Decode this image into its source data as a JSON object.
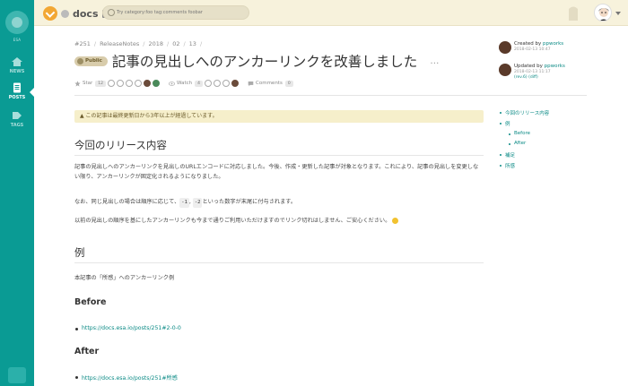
{
  "sidebar": {
    "team": "ESA",
    "items": [
      {
        "label": "NEWS"
      },
      {
        "label": "POSTS"
      },
      {
        "label": "TAGS"
      }
    ]
  },
  "topbar": {
    "brand": "docs",
    "search_placeholder": "Try category:foo tag:comments foobar"
  },
  "post": {
    "breadcrumb": [
      "#251",
      "ReleaseNotes",
      "2018",
      "02",
      "13"
    ],
    "badge": "Public",
    "title": "記事の見出しへのアンカーリンクを改善しました",
    "more": "…",
    "star_label": "Star",
    "star_count": "12",
    "watch_label": "Watch",
    "watch_count": "4",
    "comments_label": "Comments",
    "comments_count": "0"
  },
  "authors": {
    "created_prefix": "Created by",
    "created_by": "ppworks",
    "created_at": "2018-02-13 10:47",
    "updated_prefix": "Updated by",
    "updated_by": "ppworks",
    "updated_at": "2018-02-13 11:17",
    "revisions": "(rev.6) (diff)"
  },
  "alert": "この記事は最終更新日から3年以上が経過しています。",
  "content": {
    "h1_release": "今回のリリース内容",
    "p1": "記事の見出しへのアンカーリンクを見出しのURLエンコードに対応しました。今後、作成・更新した記事が対象となります。これにより、記事の見出しを変更しない限り、アンカーリンクが固定化されるようになりました。",
    "p2_pre": "なお、同じ見出しの場合は順序に応じて、",
    "p2_code1": "-1",
    "p2_code2": "-2",
    "p2_post": "といった数字が末尾に付与されます。",
    "p3": "以前の見出しの順序を基にしたアンカーリンクも今まで通りご利用いただけますのでリンク切れはしません、ご安心ください。",
    "h1_example": "例",
    "p4": "本記事の「所感」へのアンカーリンク例",
    "h2_before": "Before",
    "link_before": "https://docs.esa.io/posts/251#2-0-0",
    "h2_after": "After",
    "link_after": "https://docs.esa.io/posts/251#所感"
  },
  "toc": [
    "今回のリリース内容",
    "例",
    "Before",
    "After",
    "補足",
    "所感"
  ],
  "colors": {
    "sidebar": "#0a9b94",
    "topbar": "#f7f2dc",
    "link": "#0a8a85"
  }
}
